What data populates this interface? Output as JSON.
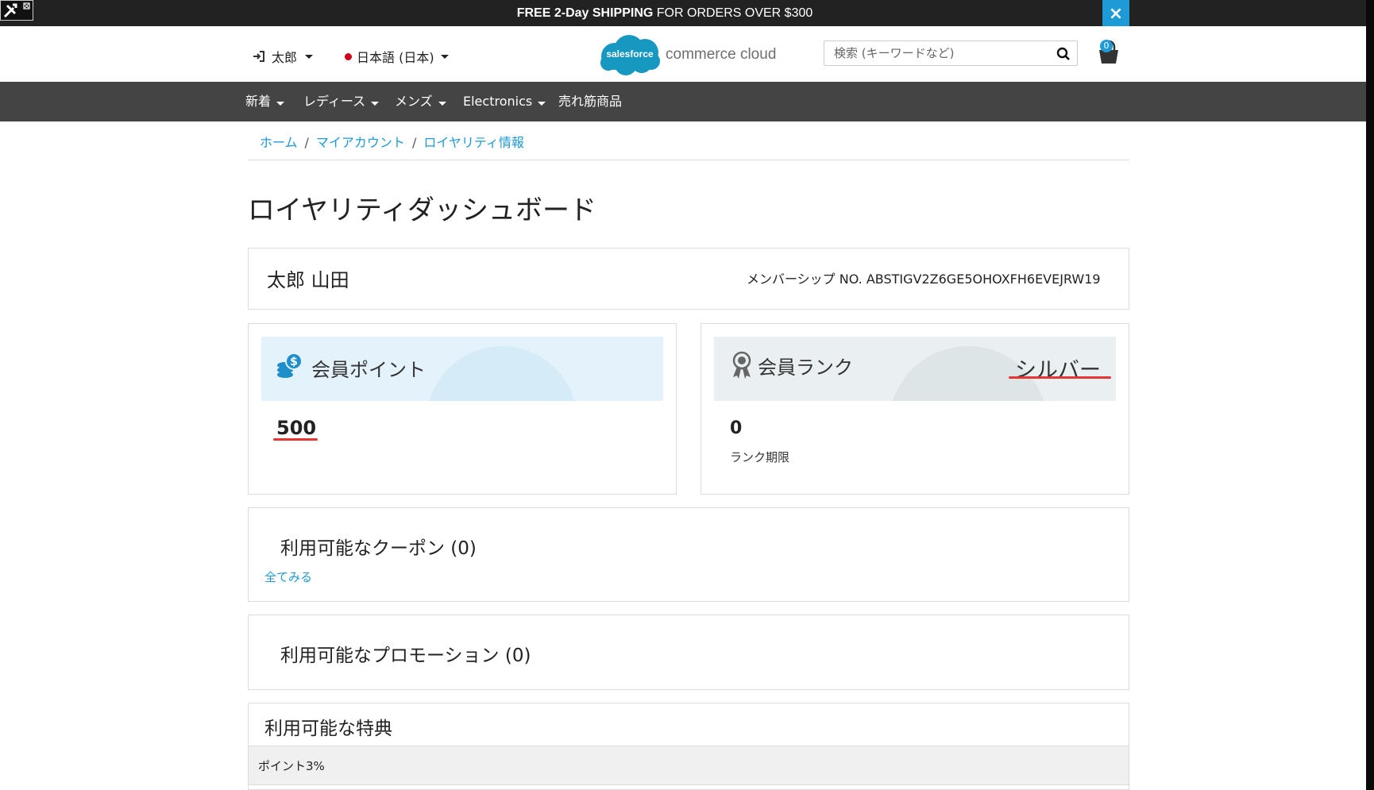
{
  "promo_bar": {
    "bold": "FREE 2-Day SHIPPING",
    "rest": " FOR ORDERS OVER $300",
    "close": "×"
  },
  "header": {
    "user": "太郎",
    "language": "日本語 (日本)",
    "logo_badge": "salesforce",
    "logo_text": "commerce cloud",
    "search_placeholder": "検索 (キーワードなど)",
    "cart_count": "0"
  },
  "nav": {
    "items": [
      {
        "label": "新着",
        "has_caret": true
      },
      {
        "label": "レディース",
        "has_caret": true
      },
      {
        "label": "メンズ",
        "has_caret": true
      },
      {
        "label": "Electronics",
        "has_caret": true
      },
      {
        "label": "売れ筋商品",
        "has_caret": false
      }
    ]
  },
  "breadcrumb": [
    "ホーム",
    "マイアカウント",
    "ロイヤリティ情報"
  ],
  "page": {
    "title": "ロイヤリティダッシュボード",
    "member_name": "太郎 山田",
    "membership_no": "メンバーシップ NO. ABSTIGV2Z6GE5OHOXFH6EVEJRW19"
  },
  "points": {
    "label": "会員ポイント",
    "value": "500"
  },
  "rank": {
    "label": "会員ランク",
    "value": "シルバー",
    "number": "0",
    "expiry_label": "ランク期限"
  },
  "coupons": {
    "title": "利用可能なクーポン (0)",
    "view_all": "全てみる"
  },
  "promotions": {
    "title": "利用可能なプロモーション (0)"
  },
  "benefits": {
    "title": "利用可能な特典",
    "items": [
      "ポイント3%"
    ]
  },
  "colors": {
    "accent": "#1e9ad6",
    "nav_bg": "#444444",
    "promo_bg": "#222222",
    "highlight_underline": "#e53535"
  }
}
